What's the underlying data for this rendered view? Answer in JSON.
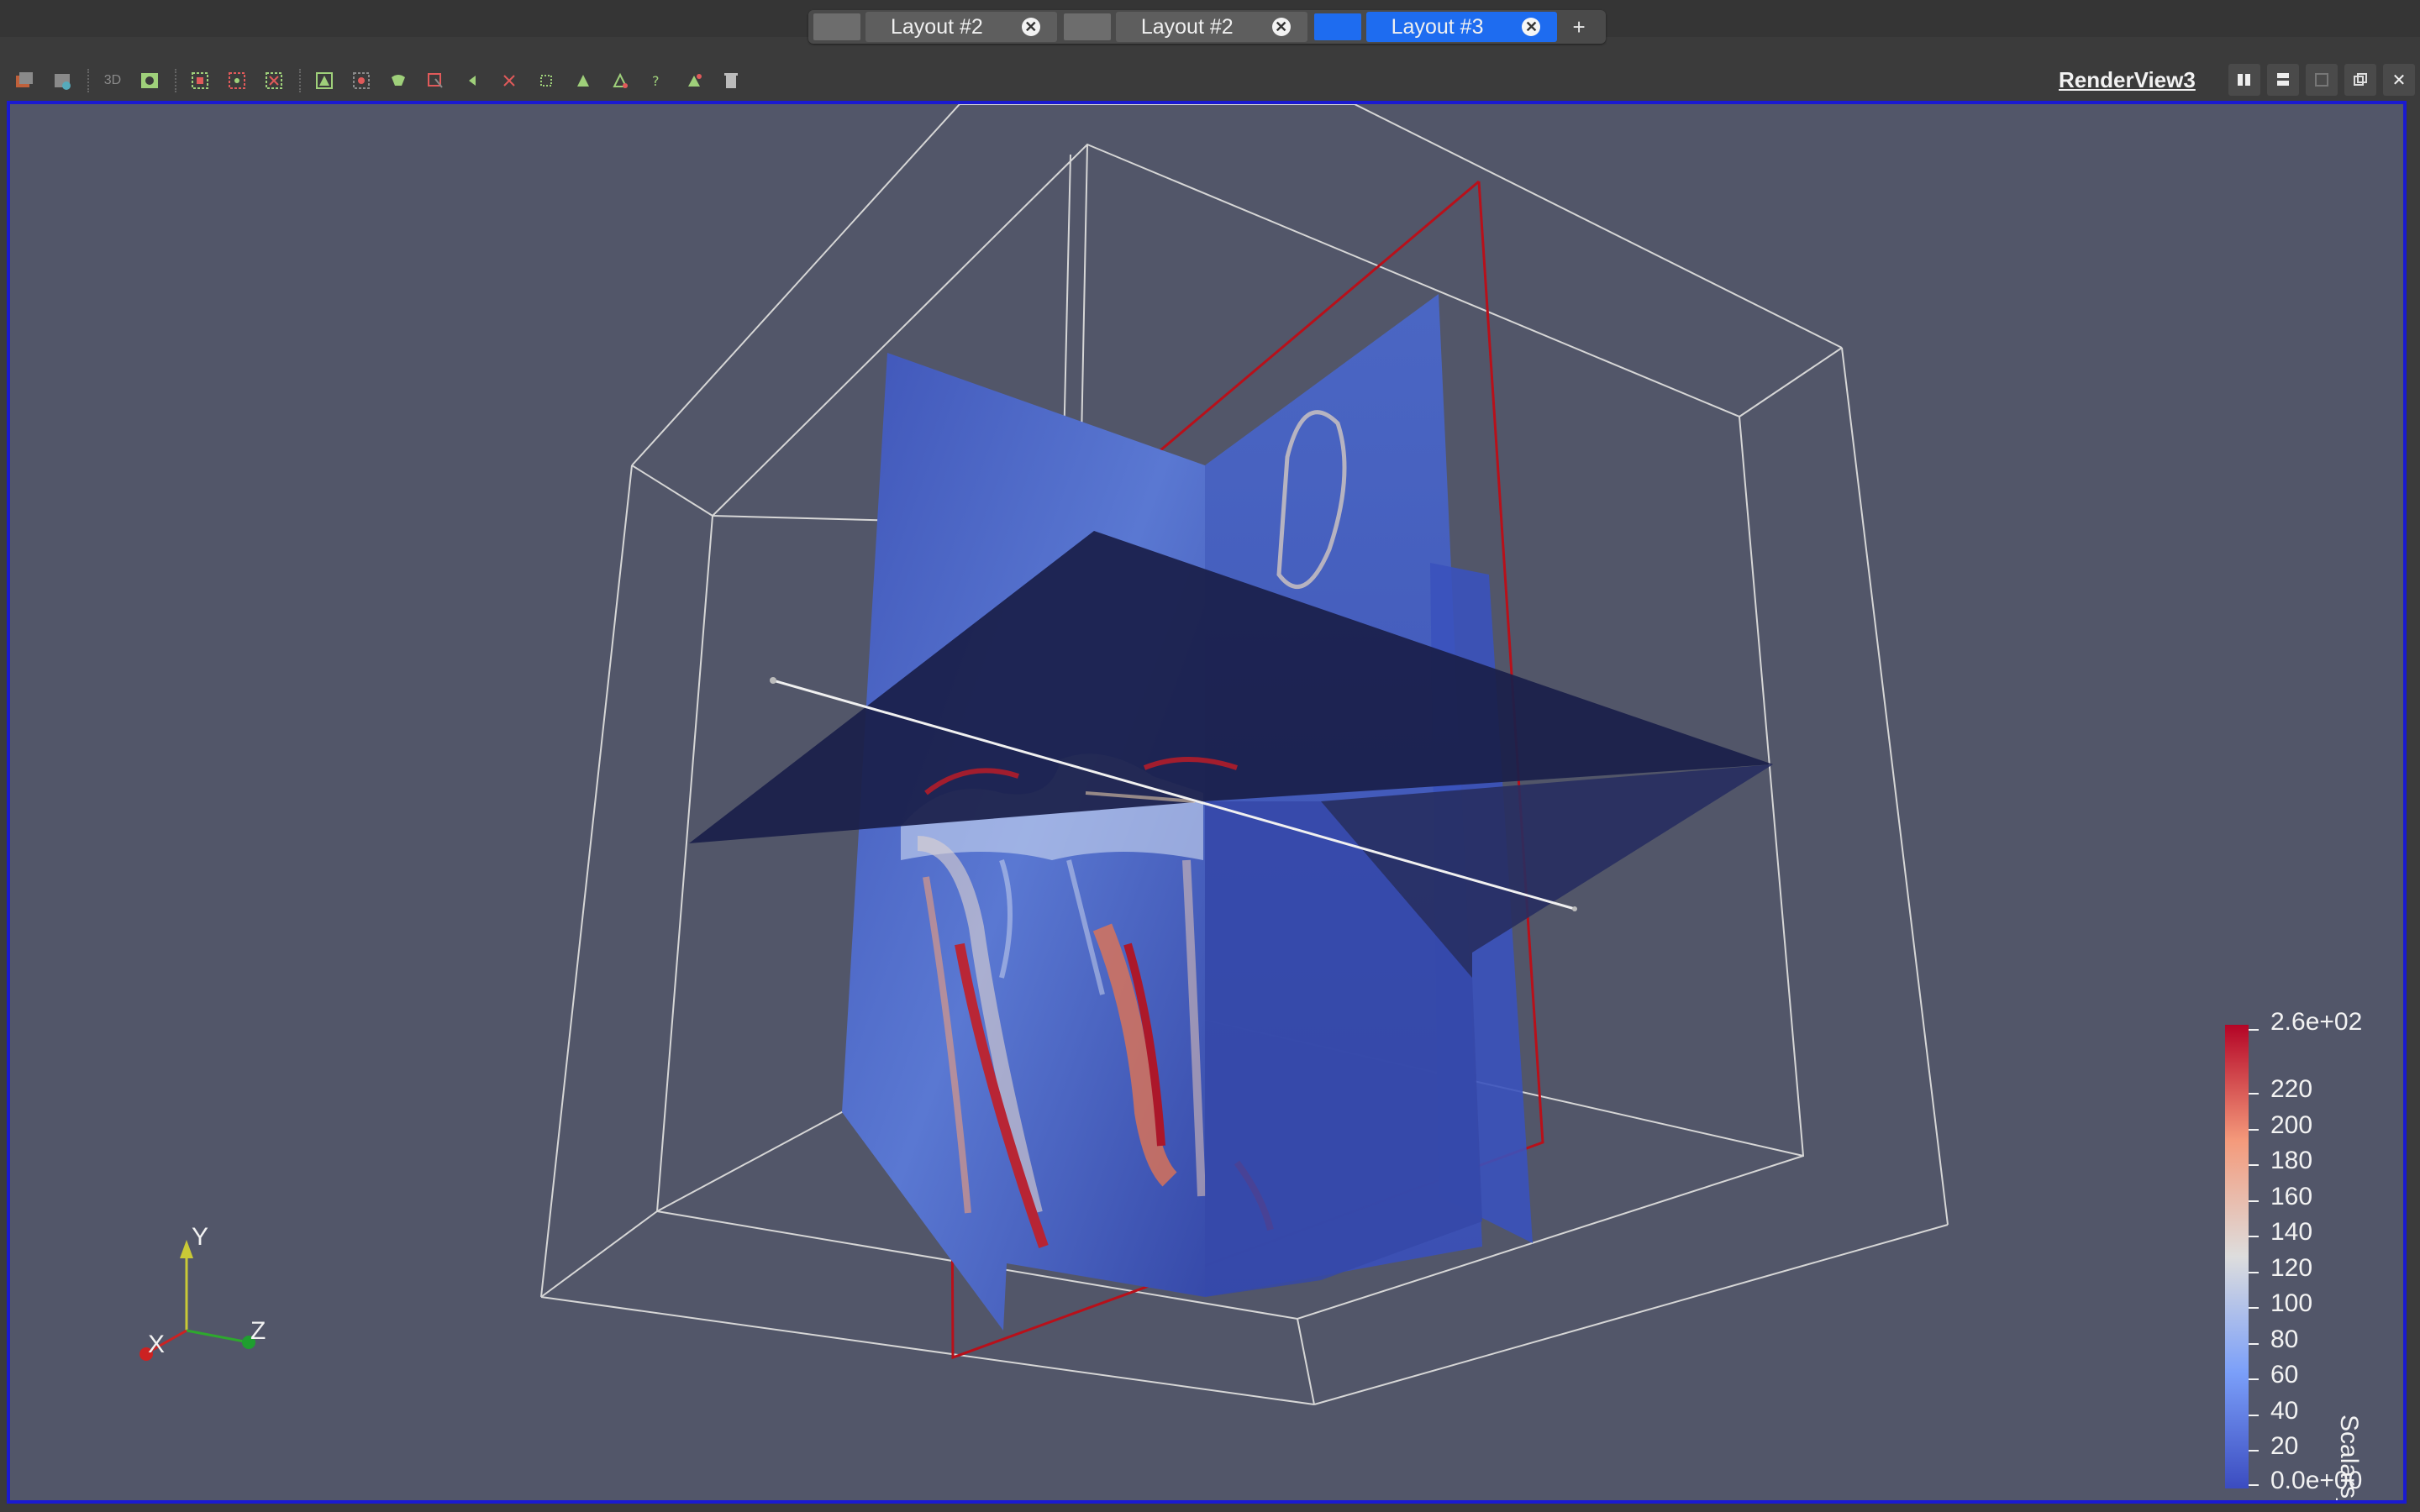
{
  "tabs": [
    {
      "label": "Layout #2",
      "active": false
    },
    {
      "label": "Layout #2",
      "active": false
    },
    {
      "label": "Layout #3",
      "active": true
    }
  ],
  "add_tab": "+",
  "view": {
    "name": "RenderView3",
    "toolbar_text": "3D"
  },
  "colorbar": {
    "title": "Scalars_",
    "max": "2.6e+02",
    "min": "0.0e+00",
    "ticks": [
      "220",
      "200",
      "180",
      "160",
      "140",
      "120",
      "100",
      "80",
      "60",
      "40",
      "20"
    ]
  },
  "axes": {
    "x": "X",
    "y": "Y",
    "z": "Z"
  },
  "colors": {
    "accent": "#1e6cf0",
    "viewport_bg": "#525669",
    "viewport_border": "#1a1ad0",
    "outline_red": "#b8101a",
    "colormap_low": "#3b4cc0",
    "colormap_mid": "#dddddd",
    "colormap_high": "#b40426"
  }
}
